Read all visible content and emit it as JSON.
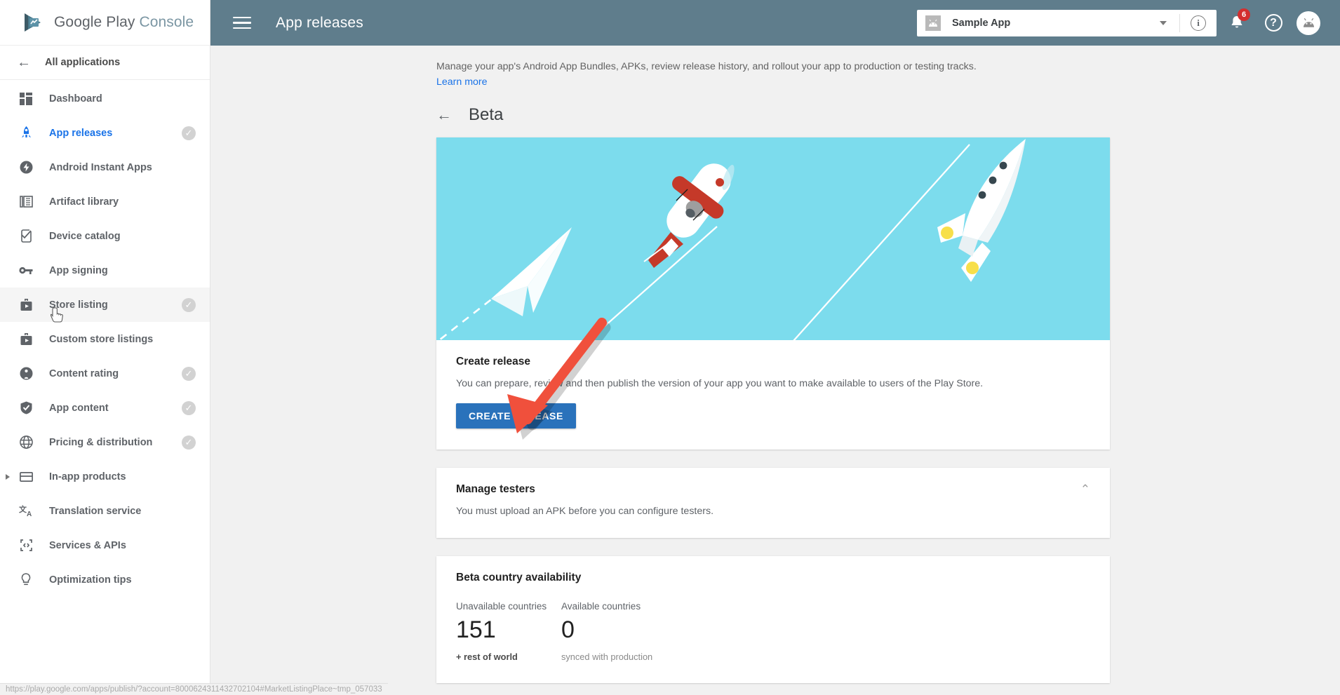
{
  "brand": {
    "word1": "Google Play",
    "word2": "Console",
    "logo_icon": "play-console-logo-icon"
  },
  "sidebar": {
    "back_label": "All applications",
    "back_icon": "arrow-left-icon",
    "items": [
      {
        "label": "Dashboard",
        "icon": "dashboard-icon",
        "selected": false,
        "check": false,
        "expander": false
      },
      {
        "label": "App releases",
        "icon": "rocket-icon",
        "selected": true,
        "check": true,
        "expander": false
      },
      {
        "label": "Android Instant Apps",
        "icon": "instant-apps-icon",
        "selected": false,
        "check": false,
        "expander": false
      },
      {
        "label": "Artifact library",
        "icon": "artifact-library-icon",
        "selected": false,
        "check": false,
        "expander": false
      },
      {
        "label": "Device catalog",
        "icon": "device-catalog-icon",
        "selected": false,
        "check": false,
        "expander": false
      },
      {
        "label": "App signing",
        "icon": "key-icon",
        "selected": false,
        "check": false,
        "expander": false
      },
      {
        "label": "Store listing",
        "icon": "store-listing-icon",
        "selected": false,
        "check": true,
        "expander": false,
        "hovered": true
      },
      {
        "label": "Custom store listings",
        "icon": "store-listing-icon",
        "selected": false,
        "check": false,
        "expander": false
      },
      {
        "label": "Content rating",
        "icon": "content-rating-icon",
        "selected": false,
        "check": true,
        "expander": false
      },
      {
        "label": "App content",
        "icon": "shield-check-icon",
        "selected": false,
        "check": true,
        "expander": false
      },
      {
        "label": "Pricing & distribution",
        "icon": "globe-icon",
        "selected": false,
        "check": true,
        "expander": false
      },
      {
        "label": "In-app products",
        "icon": "credit-card-icon",
        "selected": false,
        "check": false,
        "expander": true
      },
      {
        "label": "Translation service",
        "icon": "translate-icon",
        "selected": false,
        "check": false,
        "expander": false
      },
      {
        "label": "Services & APIs",
        "icon": "code-brackets-icon",
        "selected": false,
        "check": false,
        "expander": false
      },
      {
        "label": "Optimization tips",
        "icon": "lightbulb-icon",
        "selected": false,
        "check": false,
        "expander": false
      }
    ]
  },
  "topbar": {
    "menu_icon": "hamburger-menu-icon",
    "title": "App releases",
    "app_selector": {
      "value": "Sample App",
      "thumb_icon": "android-app-icon",
      "caret_icon": "chevron-down-icon"
    },
    "info_icon": "info-circle-icon",
    "notifications": {
      "icon": "bell-icon",
      "badge": "6"
    },
    "help_icon": "help-circle-icon",
    "avatar_icon": "android-avatar-icon"
  },
  "main": {
    "intro_text": "Manage your app's Android App Bundles, APKs, review release history, and rollout your app to production or testing tracks.",
    "learn_more": "Learn more",
    "page_title": "Beta",
    "back_icon": "arrow-left-icon",
    "hero_illustration": "paper-plane-biplane-rocket-illustration",
    "create_release": {
      "title": "Create release",
      "description": "You can prepare, review and then publish the version of your app you want to make available to users of the Play Store.",
      "button_label": "CREATE RELEASE"
    },
    "manage_testers": {
      "title": "Manage testers",
      "description": "You must upload an APK before you can configure testers.",
      "collapse_icon": "chevron-up-icon"
    },
    "country_availability": {
      "title": "Beta country availability",
      "stats": [
        {
          "label": "Unavailable countries",
          "value": "151",
          "note": "+ rest of world",
          "note_dark": true
        },
        {
          "label": "Available countries",
          "value": "0",
          "note": "synced with production",
          "note_dark": false
        }
      ]
    }
  },
  "statusbar": {
    "url": "https://play.google.com/apps/publish/?account=8000624311432702104#MarketListingPlace~tmp_057033"
  },
  "colors": {
    "topbar": "#5f7d8c",
    "accent_blue": "#1a73e8",
    "button_blue": "#2a72bb",
    "hero_sky": "#7cdced",
    "badge_red": "#d32f2f",
    "annotation_red": "#f0503c",
    "plane_red": "#c53929",
    "rocket_thruster": "#f7df4a"
  }
}
